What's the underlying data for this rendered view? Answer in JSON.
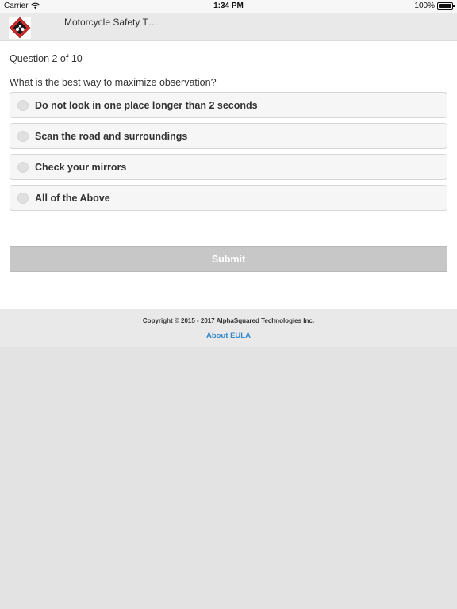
{
  "status_bar": {
    "carrier": "Carrier",
    "time": "1:34 PM",
    "battery": "100%",
    "battery_level": 1.0
  },
  "header": {
    "title": "Motorcycle Safety T…",
    "logo_icon": "motorcycle-logo-icon"
  },
  "quiz": {
    "counter": "Question 2 of 10",
    "question": "What is the best way to maximize observation?",
    "options": [
      "Do not look in one place longer than 2 seconds",
      "Scan the road and surroundings",
      "Check your mirrors",
      "All of the Above"
    ],
    "submit_label": "Submit"
  },
  "footer": {
    "copyright": "Copyright © 2015 - 2017 AlphaSquared Technologies Inc.",
    "links": [
      "About",
      "EULA"
    ]
  },
  "colors": {
    "brand_red": "#d52b2b",
    "link_blue": "#3388cc",
    "submit_disabled": "#c6c7c6"
  }
}
